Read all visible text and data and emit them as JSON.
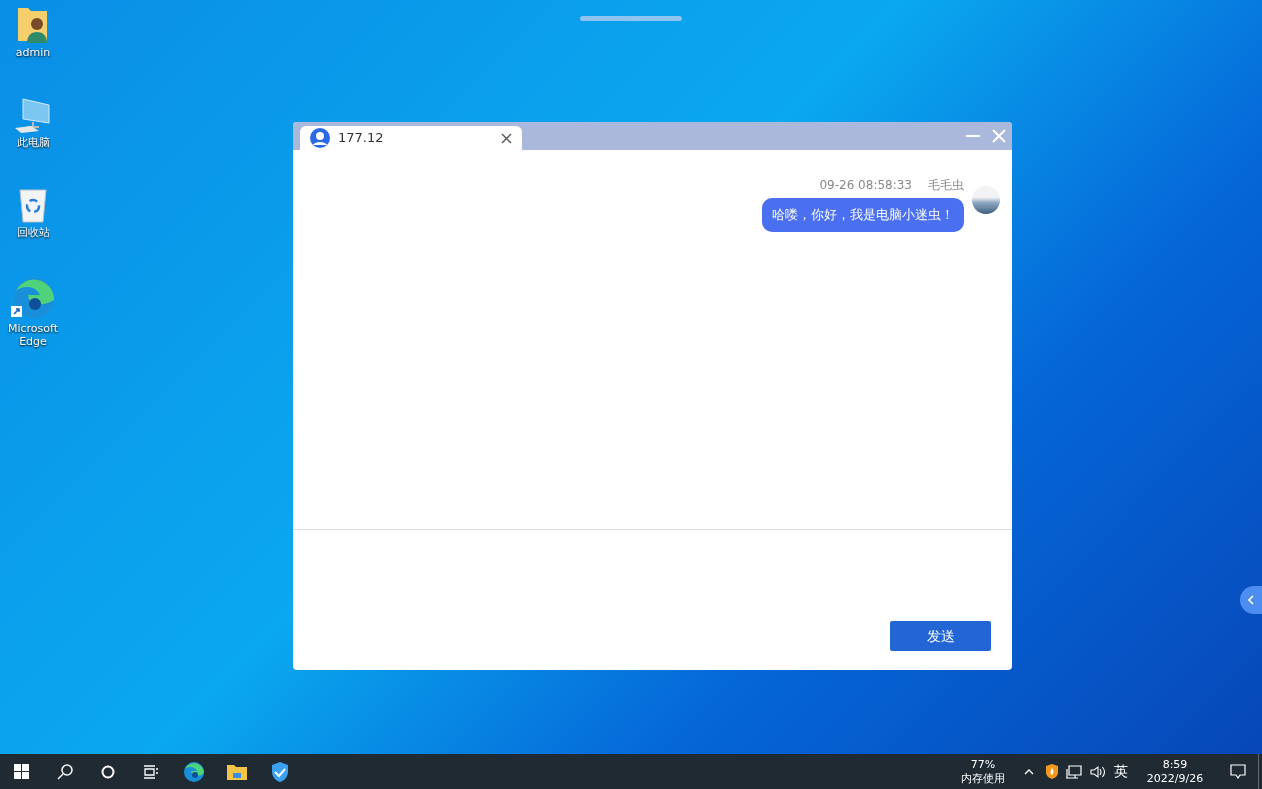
{
  "desktop_icons": [
    {
      "kind": "user-folder",
      "label": "admin"
    },
    {
      "kind": "computer",
      "label": "此电脑"
    },
    {
      "kind": "recycle-bin",
      "label": "回收站"
    },
    {
      "kind": "browser",
      "label": "Microsoft Edge"
    }
  ],
  "chat_window": {
    "tabs": [
      {
        "label": "177.12",
        "selected": true
      }
    ],
    "messages": [
      {
        "time": "09-26 08:58:33",
        "sender": "毛毛虫",
        "text": "哈喽，你好，我是电脑小迷虫！",
        "outgoing": true
      }
    ],
    "send_button": "发送"
  },
  "taskbar": {
    "memory": {
      "percent": "77%",
      "label": "内存使用"
    },
    "input_method": "英",
    "clock": {
      "time": "8:59",
      "date": "2022/9/26"
    }
  }
}
